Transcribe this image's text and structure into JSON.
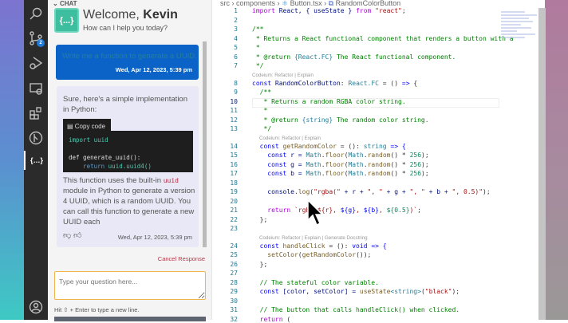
{
  "activity_bar": {
    "items": [
      "search",
      "source-control",
      "run-debug",
      "remote-explorer",
      "extensions",
      "git-graph",
      "codeium",
      "account"
    ],
    "source_control_badge": "2"
  },
  "chat": {
    "header": "CHAT",
    "logo_text": "{...}",
    "welcome_prefix": "Welcome, ",
    "user_name": "Kevin",
    "subtitle": "How can I help you today?",
    "user_message": {
      "text": "Write me a function to generate a UUID.",
      "timestamp": "Wed, Apr 12, 2023, 5:39 pm"
    },
    "assistant_message": {
      "intro": "Sure, here's a simple implementation in Python:",
      "copy_label": "Copy code",
      "code_lines": [
        [
          "import",
          " uuid"
        ],
        [
          "",
          ""
        ],
        [
          "def generate_uuid():",
          ""
        ],
        [
          "    return",
          " uuid.uuid4()"
        ]
      ],
      "text_before": "This function uses the built-in ",
      "inline_code": "uuid",
      "text_after": " module in Python to generate a version 4 UUID, which is a random UUID. You can call this function to generate a new UUID each",
      "timestamp": "Wed, Apr 12, 2023, 5:39 pm"
    },
    "cancel_label": "Cancel Response",
    "input_placeholder": "Type your question here...",
    "hint": "Hit ⇧ + Enter to type a new line.",
    "accent": "#0b63c7"
  },
  "editor": {
    "breadcrumb": [
      "src",
      "components",
      "Button.tsx",
      "RandomColorButton"
    ],
    "current_line": 10,
    "lenses": [
      {
        "after": 7,
        "indent": 0,
        "text": "Codeium: Refactor | Explain"
      },
      {
        "after": 13,
        "indent": 1,
        "text": "Codeium: Refactor | Explain"
      },
      {
        "after": 23,
        "indent": 1,
        "text": "Codeium: Refactor | Explain | Generate Docstring"
      }
    ],
    "lines": [
      [
        [
          "import",
          "k"
        ],
        [
          " React, { useState } ",
          "v"
        ],
        [
          "from",
          "k"
        ],
        [
          " \"react\"",
          "s"
        ],
        [
          ";",
          "p"
        ]
      ],
      [],
      [
        [
          "/**",
          "m"
        ]
      ],
      [
        [
          " * Returns a React functional component that renders a button with a",
          "m"
        ]
      ],
      [
        [
          " *",
          "m"
        ]
      ],
      [
        [
          " * @return ",
          "m"
        ],
        [
          "{React.FC}",
          "t"
        ],
        [
          " The React functional component.",
          "m"
        ]
      ],
      [
        [
          " */",
          "m"
        ]
      ],
      [
        [
          "const",
          "c"
        ],
        [
          " RandomColorButton",
          "v"
        ],
        [
          ": ",
          "p"
        ],
        [
          "React.FC",
          "t"
        ],
        [
          " = () ",
          "p"
        ],
        [
          "=>",
          "c"
        ],
        [
          " {",
          "p"
        ]
      ],
      [
        [
          "  /**",
          "m"
        ]
      ],
      [
        [
          "   * Returns a random RGBA color string.",
          "m"
        ]
      ],
      [
        [
          "   *",
          "m"
        ]
      ],
      [
        [
          "   * @return ",
          "m"
        ],
        [
          "{string}",
          "t"
        ],
        [
          " The random color string.",
          "m"
        ]
      ],
      [
        [
          "   */",
          "m"
        ]
      ],
      [
        [
          "  const",
          "c"
        ],
        [
          " getRandomColor",
          "f"
        ],
        [
          " = (): ",
          "p"
        ],
        [
          "string",
          "t"
        ],
        [
          " => {",
          "c"
        ]
      ],
      [
        [
          "    const",
          "c"
        ],
        [
          " r = ",
          "v"
        ],
        [
          "Math",
          "t"
        ],
        [
          ".",
          "p"
        ],
        [
          "floor",
          "f"
        ],
        [
          "(",
          "p"
        ],
        [
          "Math",
          "t"
        ],
        [
          ".",
          "p"
        ],
        [
          "random",
          "f"
        ],
        [
          "() * ",
          "p"
        ],
        [
          "256",
          "n"
        ],
        [
          ");",
          "p"
        ]
      ],
      [
        [
          "    const",
          "c"
        ],
        [
          " g = ",
          "v"
        ],
        [
          "Math",
          "t"
        ],
        [
          ".",
          "p"
        ],
        [
          "floor",
          "f"
        ],
        [
          "(",
          "p"
        ],
        [
          "Math",
          "t"
        ],
        [
          ".",
          "p"
        ],
        [
          "random",
          "f"
        ],
        [
          "() * ",
          "p"
        ],
        [
          "256",
          "n"
        ],
        [
          ");",
          "p"
        ]
      ],
      [
        [
          "    const",
          "c"
        ],
        [
          " b = ",
          "v"
        ],
        [
          "Math",
          "t"
        ],
        [
          ".",
          "p"
        ],
        [
          "floor",
          "f"
        ],
        [
          "(",
          "p"
        ],
        [
          "Math",
          "t"
        ],
        [
          ".",
          "p"
        ],
        [
          "random",
          "f"
        ],
        [
          "() * ",
          "p"
        ],
        [
          "256",
          "n"
        ],
        [
          ");",
          "p"
        ]
      ],
      [],
      [
        [
          "    console",
          "v"
        ],
        [
          ".",
          "p"
        ],
        [
          "log",
          "f"
        ],
        [
          "(",
          "p"
        ],
        [
          "\"rgba(\"",
          "s"
        ],
        [
          " + r + ",
          "v"
        ],
        [
          "\", \"",
          "s"
        ],
        [
          " + g + ",
          "v"
        ],
        [
          "\", \"",
          "s"
        ],
        [
          " + b + ",
          "v"
        ],
        [
          "\", 0.5)\"",
          "s"
        ],
        [
          ");",
          "p"
        ]
      ],
      [],
      [
        [
          "    return",
          "k"
        ],
        [
          " `rgba(${r}, ",
          "s"
        ],
        [
          "${g}",
          "c"
        ],
        [
          ", ",
          "s"
        ],
        [
          "${b}",
          "c"
        ],
        [
          ", ",
          "s"
        ],
        [
          "${0.5}",
          "n"
        ],
        [
          ")`",
          "s"
        ],
        [
          ";",
          "p"
        ]
      ],
      [
        [
          "  };",
          "p"
        ]
      ],
      [],
      [
        [
          "  const",
          "c"
        ],
        [
          " handleClick",
          "f"
        ],
        [
          " = (): ",
          "p"
        ],
        [
          "void",
          "c"
        ],
        [
          " => {",
          "c"
        ]
      ],
      [
        [
          "    setColor",
          "f"
        ],
        [
          "(",
          "p"
        ],
        [
          "getRandomColor",
          "f"
        ],
        [
          "());",
          "p"
        ]
      ],
      [
        [
          "  };",
          "p"
        ]
      ],
      [],
      [
        [
          "  // The stateful color variable.",
          "m"
        ]
      ],
      [
        [
          "  const",
          "c"
        ],
        [
          " [color, setColor] = ",
          "v"
        ],
        [
          "useState",
          "f"
        ],
        [
          "<string>",
          "t"
        ],
        [
          "(",
          "p"
        ],
        [
          "\"black\"",
          "s"
        ],
        [
          ");",
          "p"
        ]
      ],
      [],
      [
        [
          "  // The button that calls handleClick() when clicked.",
          "m"
        ]
      ],
      [
        [
          "  return",
          "k"
        ],
        [
          " (",
          "p"
        ]
      ]
    ]
  }
}
